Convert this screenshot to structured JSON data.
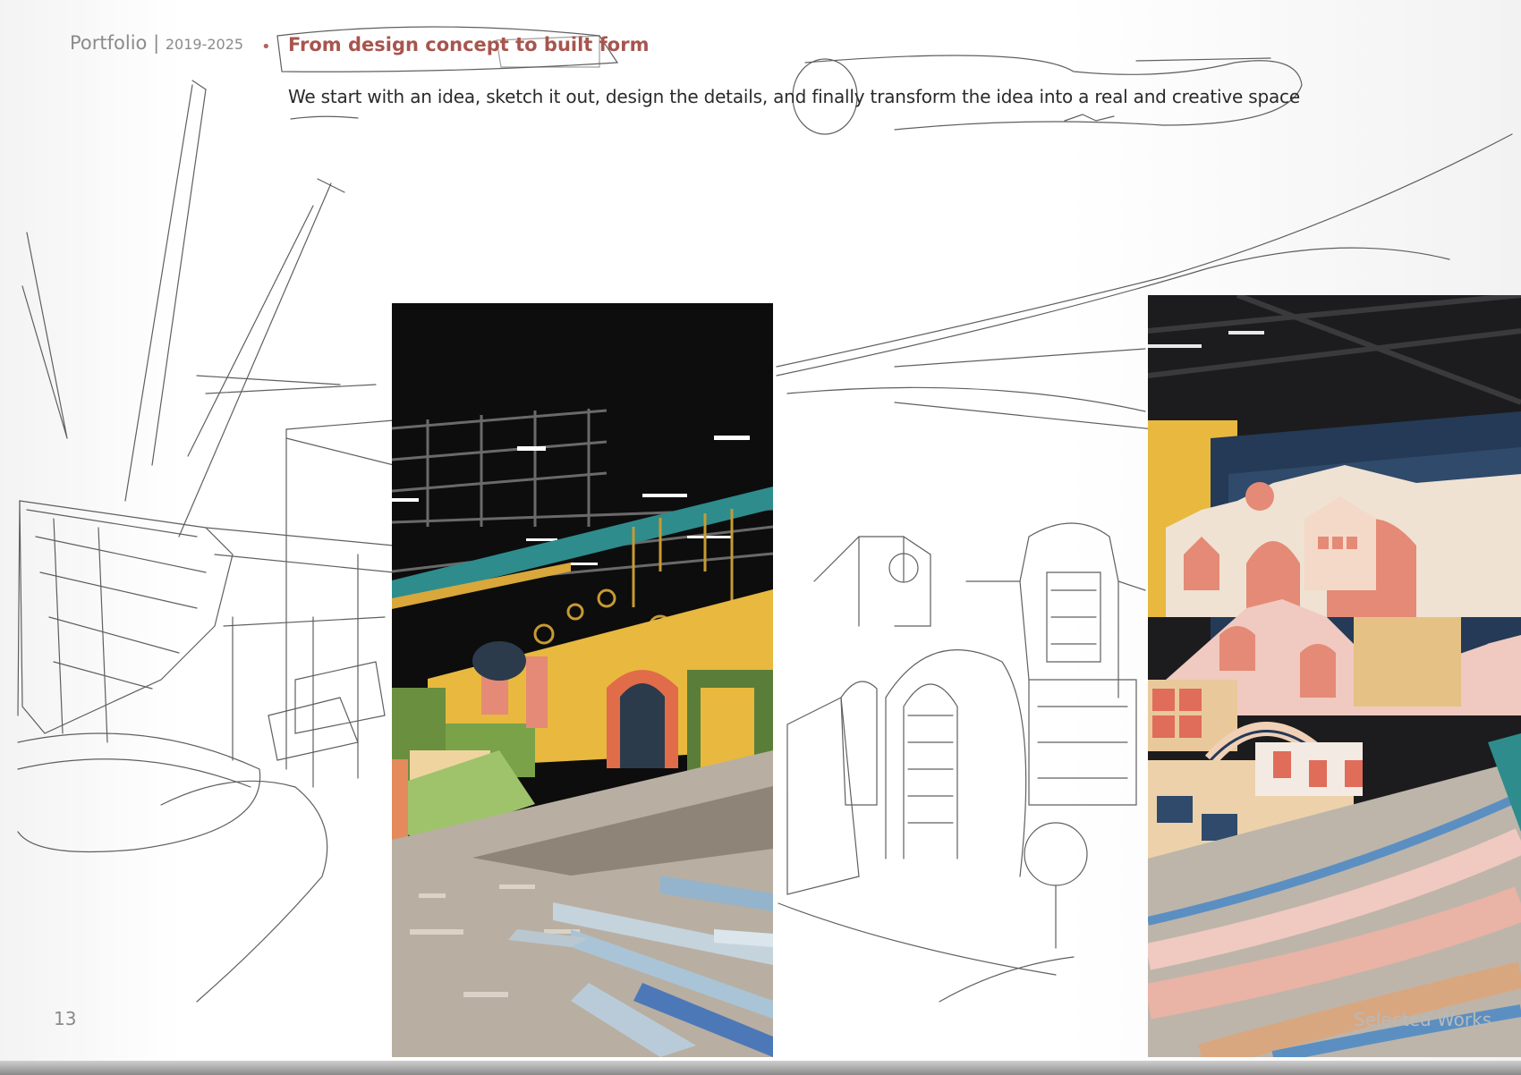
{
  "header": {
    "title": "Portfolio",
    "separator": "|",
    "years": "2019-2025"
  },
  "section": {
    "bullet": "•",
    "heading": "From design concept to built form",
    "body": "We start with an idea, sketch it out, design the details, and finally transform the idea into a real and creative space"
  },
  "footer": {
    "page_number": "13",
    "label": "Selected Works"
  },
  "colors": {
    "heading_accent": "#a7554e",
    "muted_text": "#8b8b8b",
    "render_yellow": "#e8b93e",
    "render_navy": "#243a57",
    "render_salmon": "#e48a76",
    "render_teal": "#2e8c8c"
  },
  "images": {
    "sketch_left": "pencil-sketch",
    "render_1": "playground-render",
    "sketch_right": "pencil-sketch",
    "render_2": "playground-render"
  }
}
